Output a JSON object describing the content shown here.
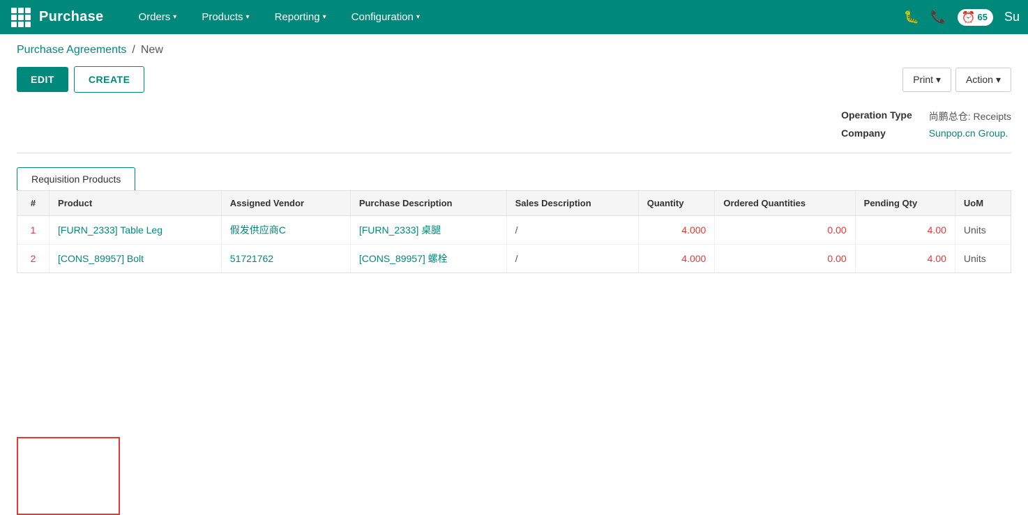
{
  "topnav": {
    "brand": "Purchase",
    "nav_items": [
      {
        "label": "Orders",
        "id": "orders"
      },
      {
        "label": "Products",
        "id": "products"
      },
      {
        "label": "Reporting",
        "id": "reporting"
      },
      {
        "label": "Configuration",
        "id": "configuration"
      }
    ],
    "badge_count": "65"
  },
  "breadcrumb": {
    "link": "Purchase Agreements",
    "separator": "/",
    "current": "New"
  },
  "toolbar": {
    "edit_label": "EDIT",
    "create_label": "CREATE",
    "print_label": "Print",
    "action_label": "Action"
  },
  "info": {
    "operation_type_label": "Operation Type",
    "operation_type_value": "尚鹏总仓: Receipts",
    "company_label": "Company",
    "company_value": "Sunpop.cn Group."
  },
  "tabs": [
    {
      "label": "Requisition Products",
      "active": true
    }
  ],
  "table": {
    "columns": [
      "#",
      "Product",
      "Assigned Vendor",
      "Purchase Description",
      "Sales Description",
      "Quantity",
      "Ordered Quantities",
      "Pending Qty",
      "UoM"
    ],
    "rows": [
      {
        "num": "1",
        "product": "[FURN_2333] Table Leg",
        "vendor": "假发供应商C",
        "purchase_desc": "[FURN_2333] 桌腿",
        "sales_desc": "/",
        "quantity": "4.000",
        "ordered_qty": "0.00",
        "pending_qty": "4.00",
        "uom": "Units"
      },
      {
        "num": "2",
        "product": "[CONS_89957] Bolt",
        "vendor": "51721762",
        "purchase_desc": "[CONS_89957] 螺栓",
        "sales_desc": "/",
        "quantity": "4.000",
        "ordered_qty": "0.00",
        "pending_qty": "4.00",
        "uom": "Units"
      }
    ]
  }
}
